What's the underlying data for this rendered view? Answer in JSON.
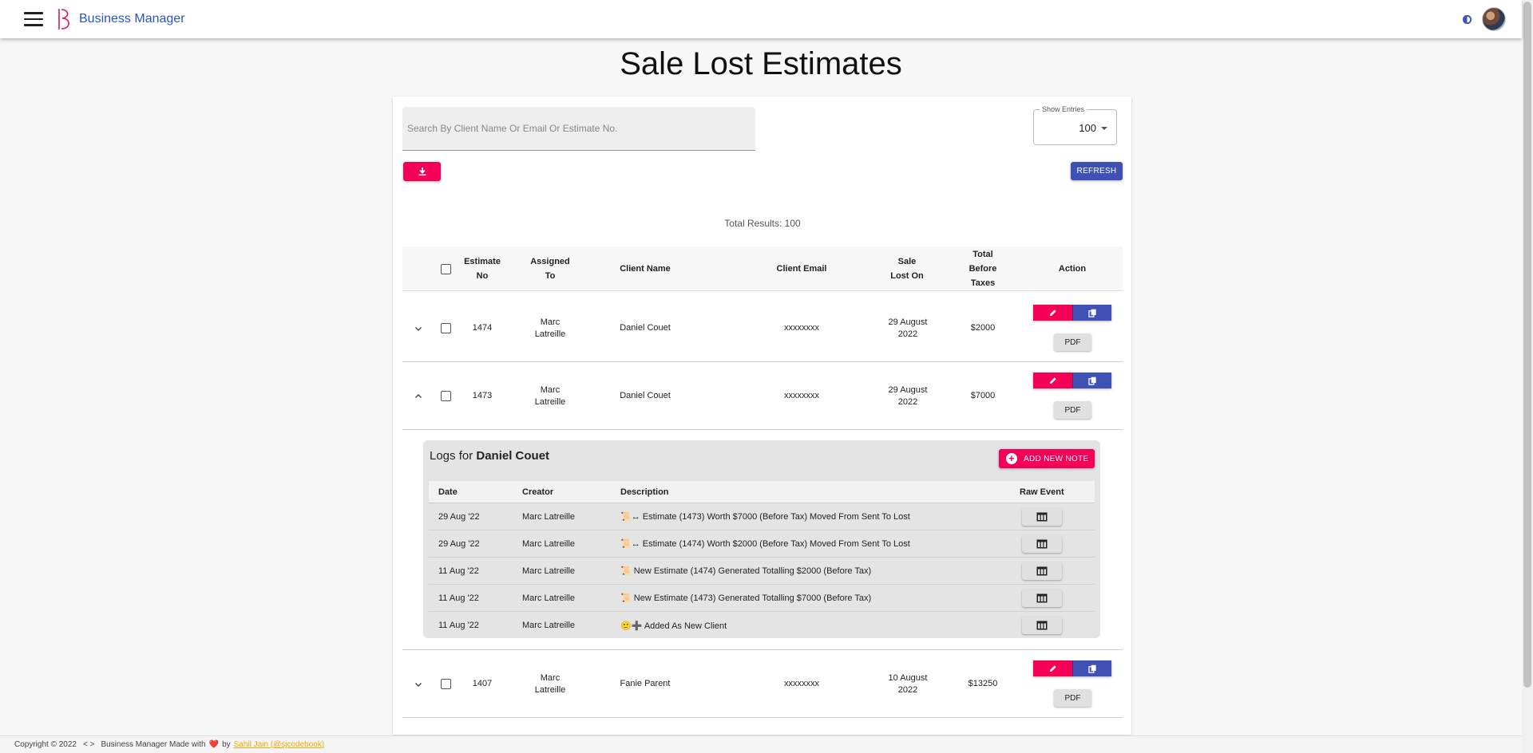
{
  "app": {
    "brand": "Business Manager"
  },
  "page": {
    "title": "Sale Lost Estimates"
  },
  "search": {
    "placeholder": "Search By Client Name Or Email Or Estimate No.",
    "value": ""
  },
  "entries": {
    "label": "Show Entries",
    "value": "100"
  },
  "toolbar": {
    "refresh_label": "REFRESH"
  },
  "total_results": "Total Results: 100",
  "table": {
    "headers": {
      "estimate_no": "Estimate No",
      "assigned_to": "Assigned To",
      "client_name": "Client Name",
      "client_email": "Client Email",
      "sale_lost_on": "Sale Lost On",
      "total_before_taxes": "Total Before Taxes",
      "action": "Action"
    },
    "rows": [
      {
        "estimate_no": "1474",
        "assigned_to": "Marc Latreille",
        "client_name": "Daniel Couet",
        "client_email": "xxxxxxxx",
        "sale_lost_on": "29 August 2022",
        "total": "$2000",
        "pdf_label": "PDF",
        "expanded": false
      },
      {
        "estimate_no": "1473",
        "assigned_to": "Marc Latreille",
        "client_name": "Daniel Couet",
        "client_email": "xxxxxxxx",
        "sale_lost_on": "29 August 2022",
        "total": "$7000",
        "pdf_label": "PDF",
        "expanded": true
      },
      {
        "estimate_no": "1407",
        "assigned_to": "Marc Latreille",
        "client_name": "Fanie Parent",
        "client_email": "xxxxxxxx",
        "sale_lost_on": "10 August 2022",
        "total": "$13250",
        "pdf_label": "PDF",
        "expanded": false
      }
    ]
  },
  "logs": {
    "title_prefix": "Logs for",
    "client": "Daniel Couet",
    "add_note_label": "ADD NEW NOTE",
    "headers": {
      "date": "Date",
      "creator": "Creator",
      "description": "Description",
      "raw_event": "Raw Event"
    },
    "rows": [
      {
        "date": "29 Aug '22",
        "creator": "Marc Latreille",
        "description": "📜↔ Estimate (1473) Worth $7000 (Before Tax) Moved From Sent To Lost"
      },
      {
        "date": "29 Aug '22",
        "creator": "Marc Latreille",
        "description": "📜↔ Estimate (1474) Worth $2000 (Before Tax) Moved From Sent To Lost"
      },
      {
        "date": "11 Aug '22",
        "creator": "Marc Latreille",
        "description": "📜 New Estimate (1474) Generated Totalling $2000 (Before Tax)"
      },
      {
        "date": "11 Aug '22",
        "creator": "Marc Latreille",
        "description": "📜 New Estimate (1473) Generated Totalling $7000 (Before Tax)"
      },
      {
        "date": "11 Aug '22",
        "creator": "Marc Latreille",
        "description": "🙂➕ Added As New Client"
      }
    ]
  },
  "footer": {
    "copyright": "Copyright © 2022",
    "code_glyph": "< >",
    "made_with": "Business Manager Made with",
    "heart": "❤️",
    "by": "by",
    "author_link": "Sahil Jain (@sjcodebook)"
  },
  "colors": {
    "accent": "#f50057",
    "primary": "#3f51b5",
    "brand": "#2a54c6"
  },
  "icons": {
    "menu": "hamburger-menu-icon",
    "theme": "brightness-icon",
    "download": "download-icon",
    "edit": "pencil-icon",
    "copy": "copy-icon",
    "expand": "chevron-down-icon",
    "collapse": "chevron-up-icon",
    "raw_event": "table-icon",
    "add": "add-circle-icon"
  }
}
